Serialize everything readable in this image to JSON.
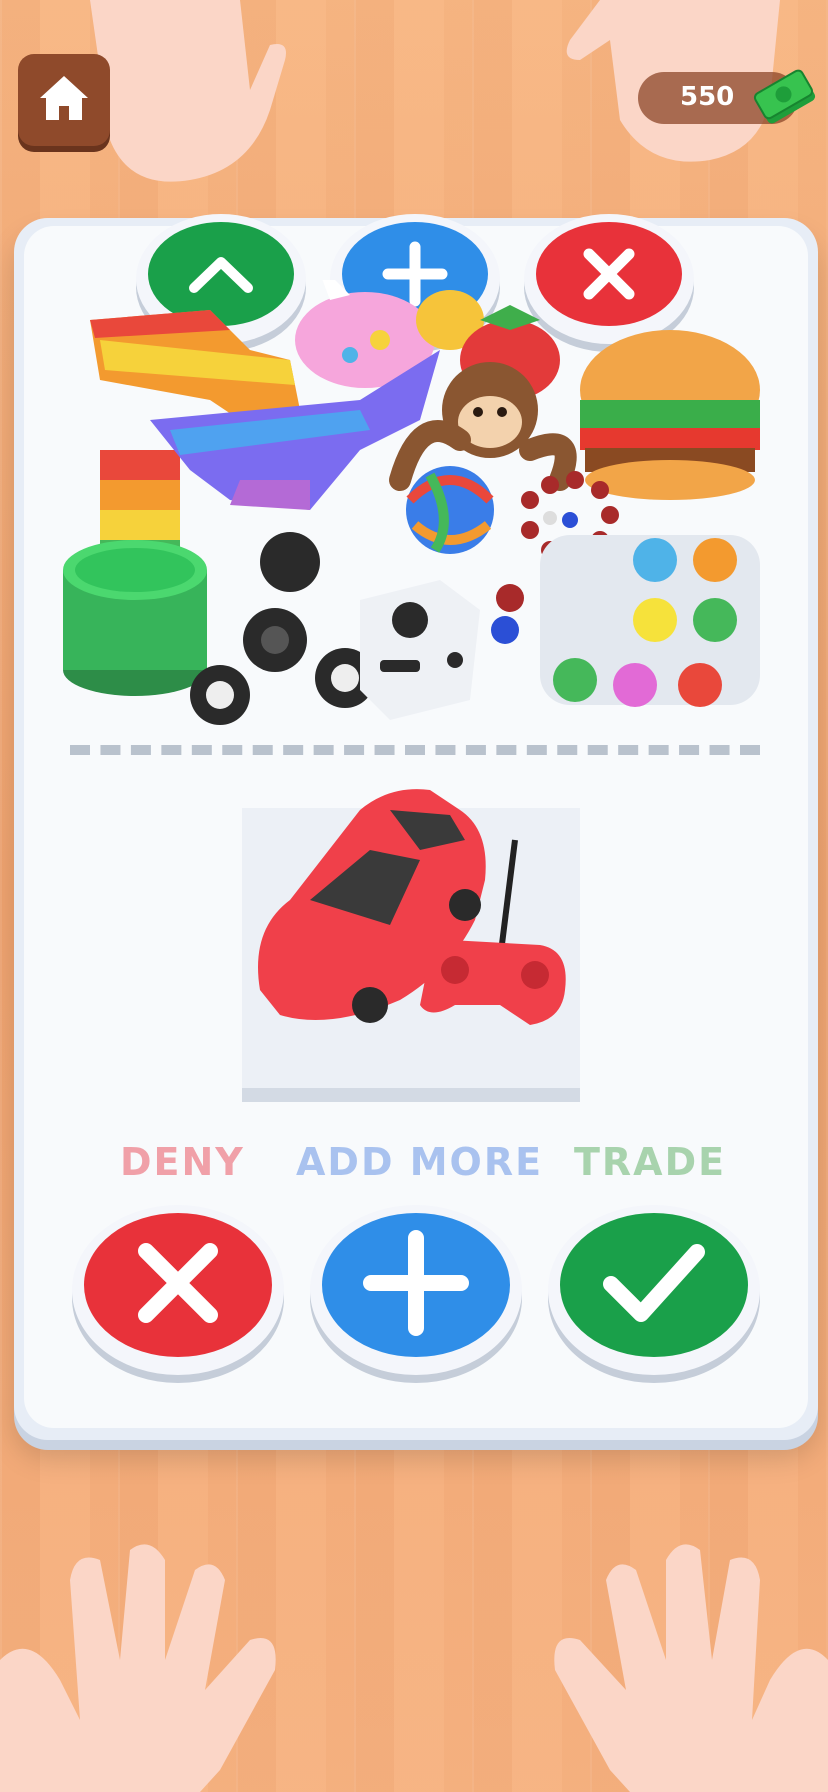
{
  "hud": {
    "home_icon": "home-icon",
    "cash_amount": "550",
    "cash_icon": "cash-icon"
  },
  "top_buttons": [
    {
      "icon": "caret-up-icon",
      "color": "#1aa04a"
    },
    {
      "icon": "plus-icon",
      "color": "#2f8ee8"
    },
    {
      "icon": "close-icon",
      "color": "#e8323a"
    }
  ],
  "offered_items": [
    "pop-it-dinosaur",
    "pop-it-unicorn",
    "pop-it-rainbow-square",
    "strawberry",
    "banana",
    "monkey-plush",
    "burger-squishy",
    "slime-jar",
    "fidget-spinner",
    "fidget-cube",
    "rubber-band-ball",
    "bead-bracelet",
    "simple-dimple"
  ],
  "requested_item": "rc-car-with-remote",
  "actions": {
    "deny_label": "DENY",
    "add_more_label": "ADD MORE",
    "trade_label": "TRADE"
  },
  "colors": {
    "deny": "#e8323a",
    "add": "#2f8ee8",
    "trade": "#1aa04a",
    "deny_label": "#f0a0a8",
    "add_label": "#a9c2ef",
    "trade_label": "#a8d3ad"
  }
}
